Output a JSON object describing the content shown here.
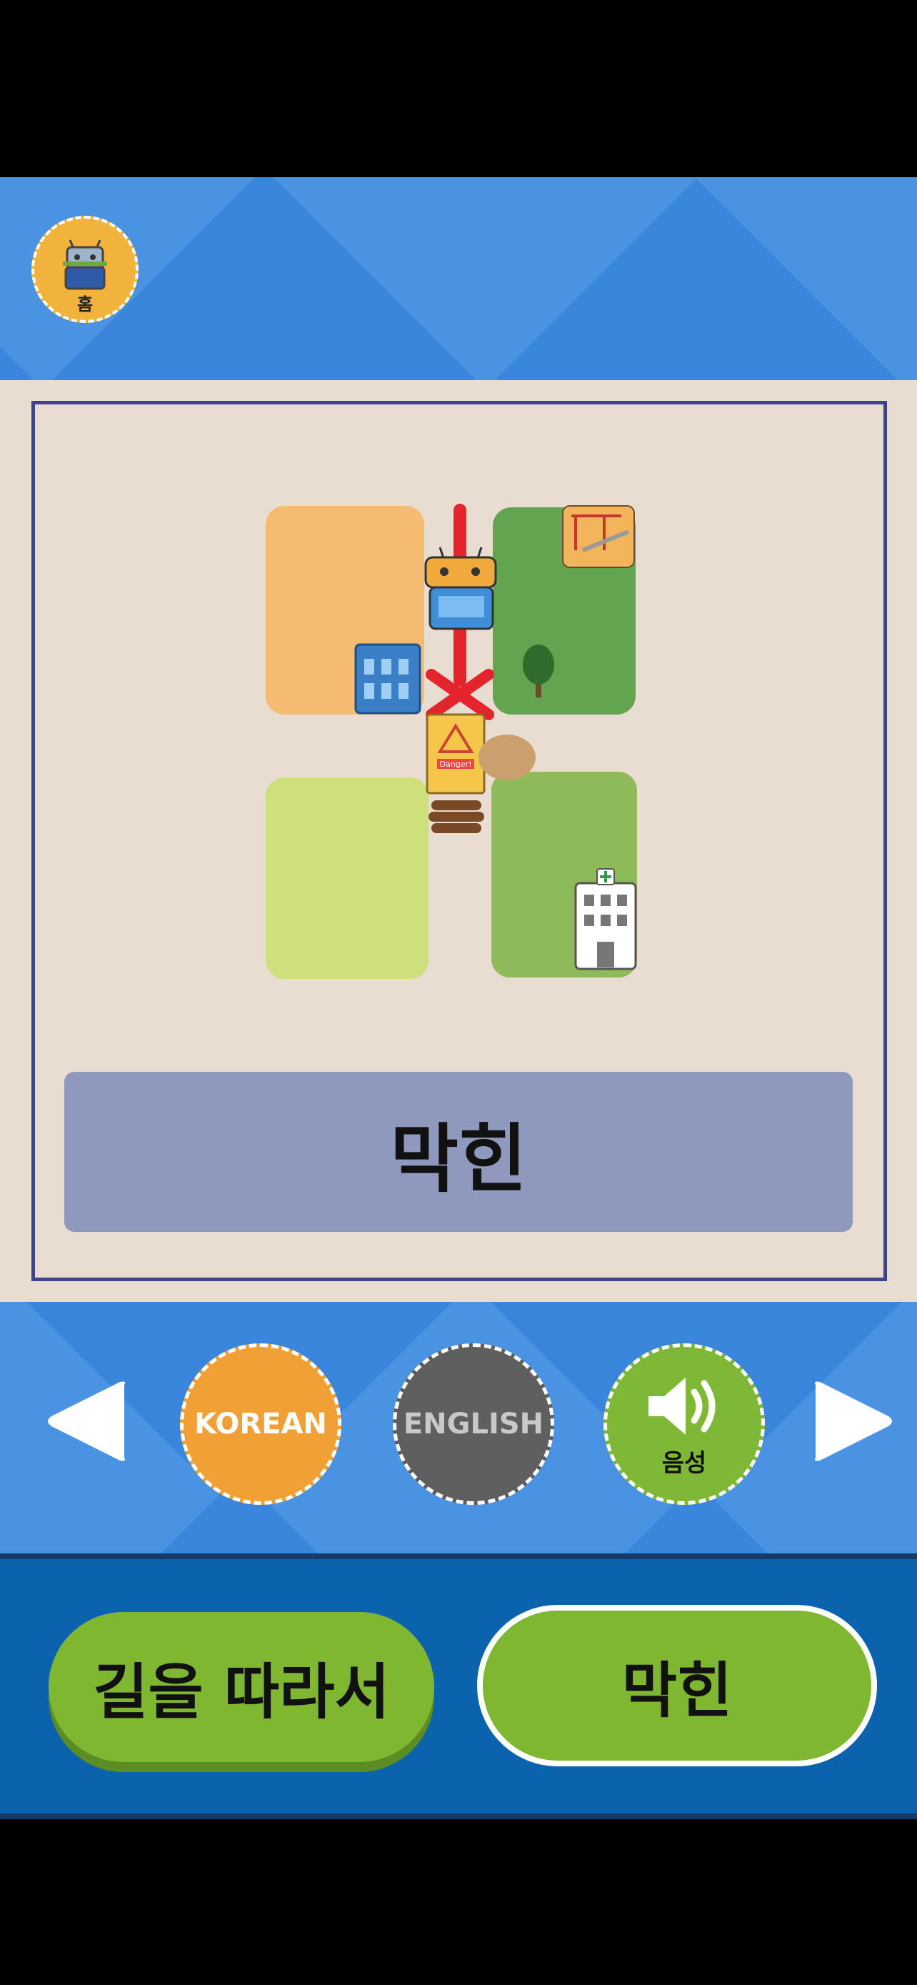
{
  "header": {
    "home_label": "홈"
  },
  "card": {
    "word": "막힌"
  },
  "language": {
    "korean_label": "KOREAN",
    "english_label": "ENGLISH",
    "sound_label": "음성"
  },
  "bottom": {
    "left_label": "길을 따라서",
    "right_label": "막힌"
  },
  "map_sign": "Danger!",
  "colors": {
    "header_blue": "#3a86dc",
    "panel_beige": "#e9ddd1",
    "word_box": "#8f98bd",
    "korean_orange": "#f0a035",
    "english_gray": "#5f5f5f",
    "green_button": "#7fb731",
    "bottom_blue": "#0b63ae"
  }
}
